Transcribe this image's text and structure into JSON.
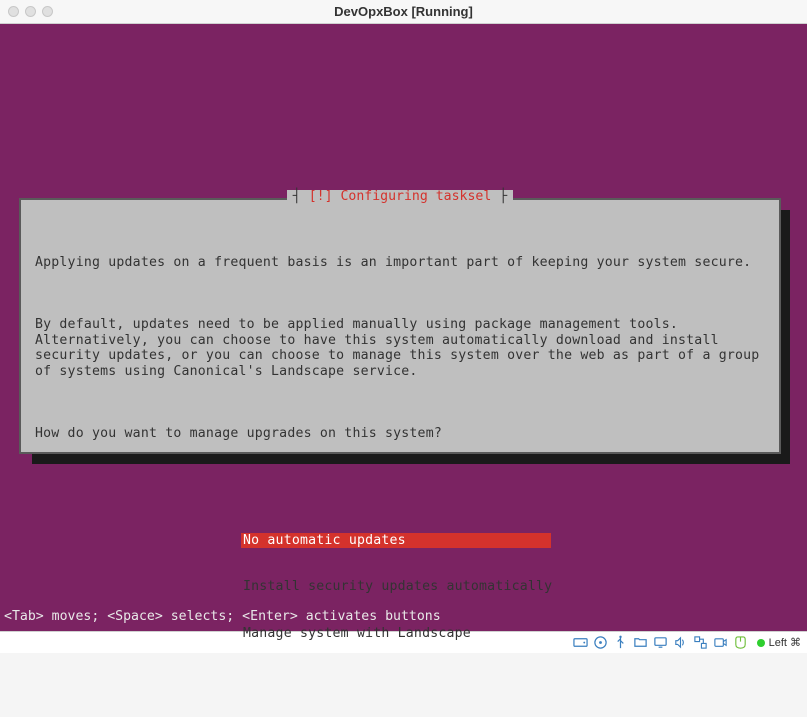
{
  "window": {
    "title": "DevOpxBox [Running]"
  },
  "dialog": {
    "title_bracket_left": "┤",
    "title_bracket_right": "├",
    "title": " [!] Configuring tasksel ",
    "paragraphs": [
      "Applying updates on a frequent basis is an important part of keeping your system secure.",
      "By default, updates need to be applied manually using package management tools. Alternatively, you can choose to have this system automatically download and install security updates, or you can choose to manage this system over the web as part of a group of systems using Canonical's Landscape service.",
      "How do you want to manage upgrades on this system?"
    ],
    "options": [
      {
        "label": "No automatic updates",
        "selected": true
      },
      {
        "label": "Install security updates automatically",
        "selected": false
      },
      {
        "label": "Manage system with Landscape",
        "selected": false
      }
    ]
  },
  "help_bar": "<Tab> moves; <Space> selects; <Enter> activates buttons",
  "status": {
    "host_key": "Left ⌘"
  }
}
